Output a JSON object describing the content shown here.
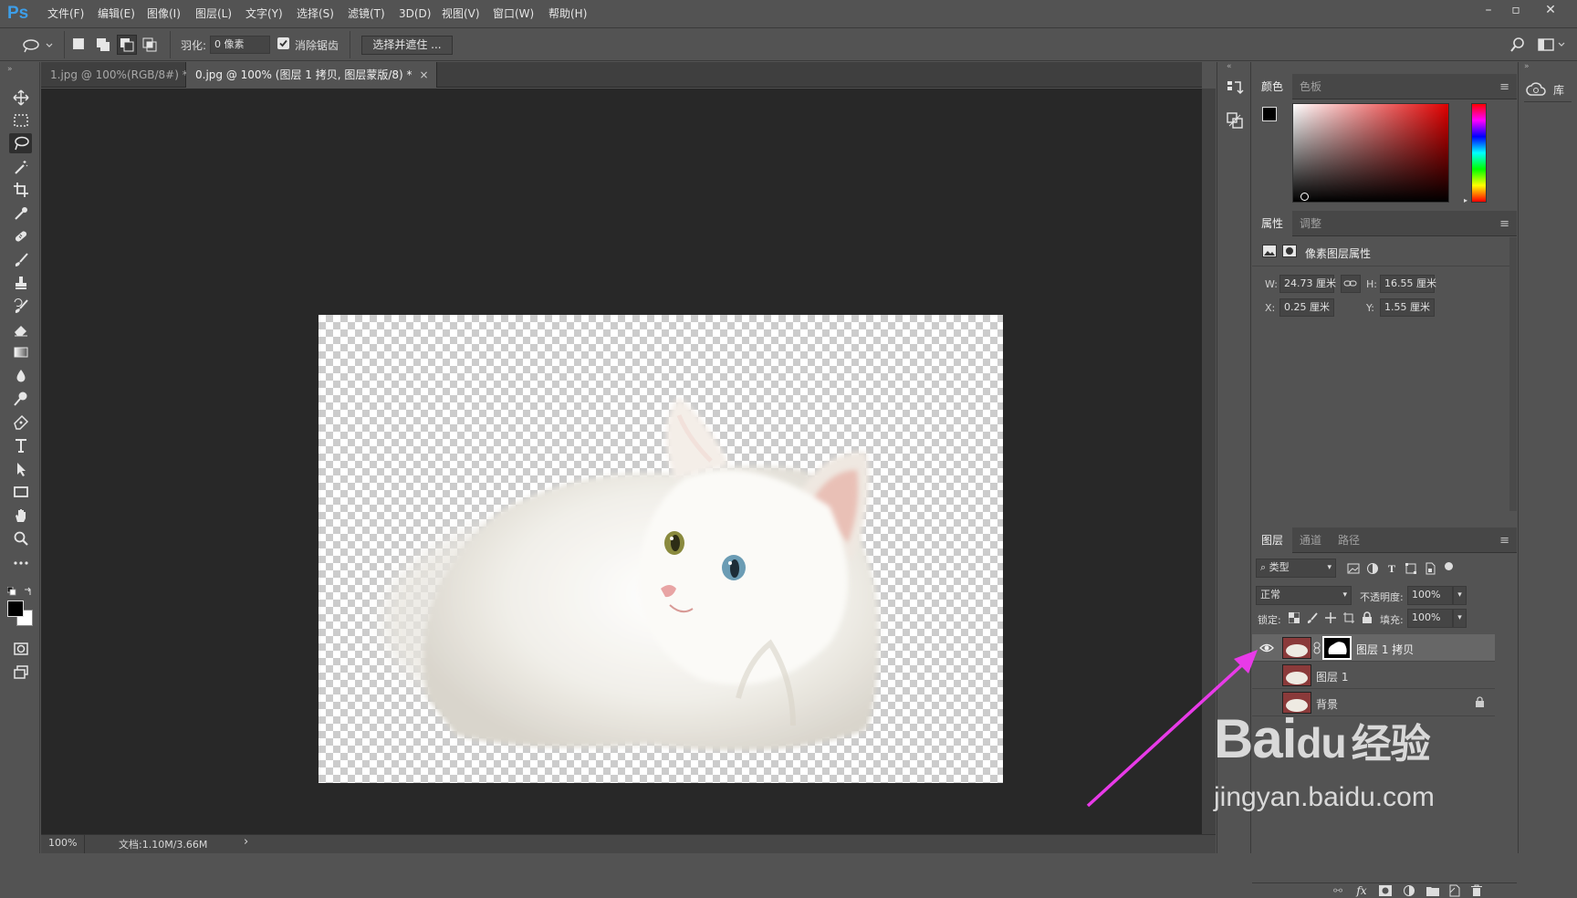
{
  "app": {
    "logo": "Ps"
  },
  "menubar": {
    "items": [
      "文件(F)",
      "编辑(E)",
      "图像(I)",
      "图层(L)",
      "文字(Y)",
      "选择(S)",
      "滤镜(T)",
      "3D(D)",
      "视图(V)",
      "窗口(W)",
      "帮助(H)"
    ],
    "window_controls": {
      "minimize": "–",
      "maximize": "▫",
      "close": "✕"
    }
  },
  "options_bar": {
    "feather_label": "羽化:",
    "feather_value": "0 像素",
    "antialias_label": "消除锯齿",
    "antialias_checked": true,
    "select_mask_button": "选择并遮住 ..."
  },
  "tabs": [
    {
      "label": "1.jpg @ 100%(RGB/8#) *",
      "close": "×"
    },
    {
      "label": "0.jpg @ 100% (图层 1 拷贝, 图层蒙版/8) *",
      "close": "×"
    }
  ],
  "status": {
    "zoom": "100%",
    "doc": "文档:1.10M/3.66M",
    "arrow": "›"
  },
  "color_panel": {
    "tabs": [
      "颜色",
      "色板"
    ]
  },
  "properties_panel": {
    "tabs": [
      "属性",
      "调整"
    ],
    "title": "像素图层属性",
    "w_label": "W:",
    "w_value": "24.73 厘米",
    "h_label": "H:",
    "h_value": "16.55 厘米",
    "x_label": "X:",
    "x_value": "0.25 厘米",
    "y_label": "Y:",
    "y_value": "1.55 厘米"
  },
  "layers_panel": {
    "tabs": [
      "图层",
      "通道",
      "路径"
    ],
    "filter_type": "类型",
    "blend_mode": "正常",
    "opacity_label": "不透明度:",
    "opacity_value": "100%",
    "lock_label": "锁定:",
    "fill_label": "填充:",
    "fill_value": "100%",
    "layers": [
      {
        "name": "图层 1 拷贝",
        "visible": true,
        "selected": true,
        "has_mask": true
      },
      {
        "name": "图层 1",
        "visible": false,
        "selected": false
      },
      {
        "name": "背景",
        "visible": false,
        "selected": false,
        "locked": true
      }
    ],
    "footer_fx": "fx"
  },
  "libraries": {
    "label": "库"
  },
  "watermark": {
    "brand": "Bai",
    "paw": "du",
    "suffix": "经验",
    "url": "jingyan.baidu.com"
  },
  "colors": {
    "annotation_arrow": "#e83ae8",
    "selection_blue": "#3d9ee8"
  }
}
